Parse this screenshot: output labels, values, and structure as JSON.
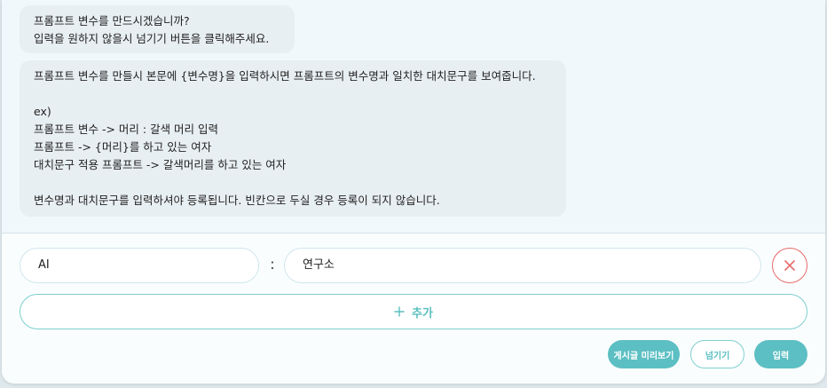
{
  "chat": {
    "message_1": {
      "lines": [
        "프롬프트 변수를 만드시겠습니까?",
        "입력을 원하지 않을시 넘기기 버튼을 클릭해주세요."
      ]
    },
    "message_2": {
      "lines": [
        "프롬프트 변수를 만들시 본문에 {변수명}을 입력하시면 프롬프트의 변수명과 일치한 대치문구를 보여줍니다.",
        "",
        "ex)",
        "프롬프트 변수 -> 머리 : 갈색 머리 입력",
        "프롬프트 -> {머리}를 하고 있는 여자",
        "대치문구 적용 프롬프트 -> 갈색머리를 하고 있는 여자",
        "",
        "변수명과 대치문구를 입력하셔야 등록됩니다. 빈칸으로 두실 경우 등록이 되지 않습니다."
      ]
    }
  },
  "variable_row": {
    "name_value": "AI",
    "separator": ":",
    "replacement_value": "연구소",
    "delete_icon": "close-icon"
  },
  "add_button": {
    "icon": "plus-icon",
    "label": "추가"
  },
  "actions": {
    "preview_label": "게시글 미리보기",
    "skip_label": "넘기기",
    "submit_label": "입력"
  },
  "colors": {
    "accent": "#5cbfc3",
    "accent_border": "#7ecfcf",
    "delete": "#e46a6a",
    "bubble_bg": "#e8eff2"
  }
}
